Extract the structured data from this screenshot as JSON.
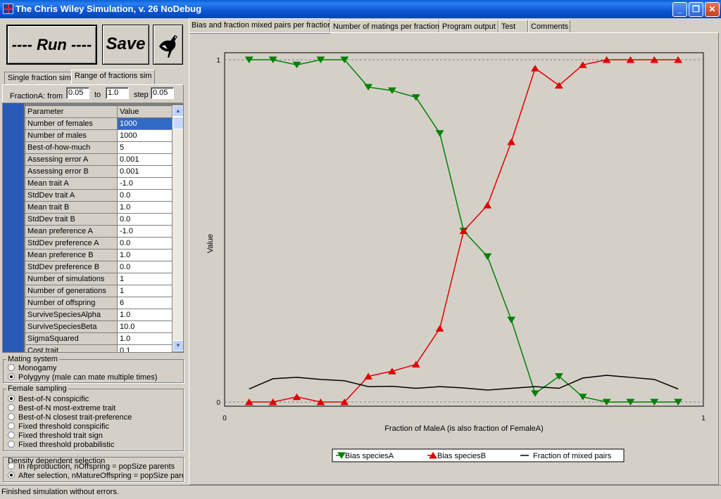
{
  "window": {
    "title": "The Chris Wiley Simulation, v. 26 NoDebug",
    "minimize": "_",
    "maximize": "❐",
    "close": "✕"
  },
  "toolbar": {
    "run_label": "---- Run ----",
    "save_label": "Save"
  },
  "left_tabs": [
    "Single fraction sim",
    "Range of fractions sim"
  ],
  "fraction_range": {
    "from_label": "FractionA: from",
    "from_value": "0.05",
    "to_label": "to",
    "to_value": "1.0",
    "step_label": "step",
    "step_value": "0.05"
  },
  "params": {
    "header": {
      "name": "Parameter",
      "value": "Value"
    },
    "rows": [
      {
        "name": "Number of females",
        "value": "1000"
      },
      {
        "name": "Number of males",
        "value": "1000"
      },
      {
        "name": "Best-of-how-much",
        "value": "5"
      },
      {
        "name": "Assessing error A",
        "value": "0.001"
      },
      {
        "name": "Assessing error B",
        "value": "0.001"
      },
      {
        "name": "Mean trait A",
        "value": "-1.0"
      },
      {
        "name": "StdDev trait A",
        "value": "0.0"
      },
      {
        "name": "Mean trait B",
        "value": "1.0"
      },
      {
        "name": "StdDev trait B",
        "value": "0.0"
      },
      {
        "name": "Mean preference A",
        "value": "-1.0"
      },
      {
        "name": "StdDev preference A",
        "value": "0.0"
      },
      {
        "name": "Mean preference B",
        "value": "1.0"
      },
      {
        "name": "StdDev preference B",
        "value": "0.0"
      },
      {
        "name": "Number of simulations",
        "value": "1"
      },
      {
        "name": "Number of generations",
        "value": "1"
      },
      {
        "name": "Number of offspring",
        "value": "6"
      },
      {
        "name": "SurviveSpeciesAlpha",
        "value": "1.0"
      },
      {
        "name": "SurviveSpeciesBeta",
        "value": "10.0"
      },
      {
        "name": "SigmaSquared",
        "value": "1.0"
      },
      {
        "name": "Cost trait",
        "value": "0.1"
      }
    ]
  },
  "mating_system": {
    "title": "Mating system",
    "options": [
      {
        "label": "Monogamy",
        "checked": false
      },
      {
        "label": "Polygyny (male can mate multiple times)",
        "checked": true
      }
    ]
  },
  "female_sampling": {
    "title": "Female sampling",
    "options": [
      {
        "label": "Best-of-N conspicific",
        "checked": true
      },
      {
        "label": "Best-of-N most-extreme trait",
        "checked": false
      },
      {
        "label": "Best-of-N closest trait-preference",
        "checked": false
      },
      {
        "label": "Fixed threshold conspicific",
        "checked": false
      },
      {
        "label": "Fixed threshold trait sign",
        "checked": false
      },
      {
        "label": "Fixed threshold probabilistic",
        "checked": false
      }
    ]
  },
  "density": {
    "title": "Density dependent selection",
    "options": [
      {
        "label": "In reproduction, nOffspring = popSize parents",
        "checked": false
      },
      {
        "label": "After selection, nMatureOffspring = popSize parents",
        "checked": true
      }
    ]
  },
  "right_tabs": [
    "Bias and fraction mixed pairs per fraction",
    "Number of matings per fraction",
    "Program output",
    "Test",
    "Comments"
  ],
  "status": "Finished simulation without errors.",
  "colors": {
    "green": "#008000",
    "red": "#e00000",
    "black": "#000000"
  },
  "chart_data": {
    "type": "line",
    "xlabel": "Fraction of MaleA (is also fraction of FemaleA)",
    "ylabel": "Value",
    "xlim": [
      0,
      1
    ],
    "ylim": [
      0,
      1
    ],
    "x_ticks": [
      "0",
      "1"
    ],
    "y_ticks": [
      "0",
      "1"
    ],
    "legend_position": "bottom",
    "x": [
      0.05,
      0.1,
      0.15,
      0.2,
      0.25,
      0.3,
      0.35,
      0.4,
      0.45,
      0.5,
      0.55,
      0.6,
      0.65,
      0.7,
      0.75,
      0.8,
      0.85,
      0.9,
      0.95
    ],
    "series": [
      {
        "name": "Bias speciesA",
        "color": "#008000",
        "marker": "triangle-down",
        "values": [
          1.0,
          1.0,
          0.985,
          1.0,
          1.0,
          0.92,
          0.91,
          0.89,
          0.785,
          0.5,
          0.425,
          0.24,
          0.025,
          0.075,
          0.015,
          0.0,
          0.0,
          0.0,
          0.0
        ]
      },
      {
        "name": "Bias speciesB",
        "color": "#e00000",
        "marker": "triangle-up",
        "values": [
          0.0,
          0.0,
          0.015,
          0.0,
          0.0,
          0.075,
          0.09,
          0.11,
          0.215,
          0.5,
          0.575,
          0.76,
          0.975,
          0.925,
          0.985,
          1.0,
          1.0,
          1.0,
          1.0
        ]
      },
      {
        "name": "Fraction of mixed pairs",
        "color": "#000000",
        "marker": "none",
        "values": [
          0.038,
          0.068,
          0.072,
          0.066,
          0.062,
          0.045,
          0.046,
          0.04,
          0.045,
          0.041,
          0.035,
          0.04,
          0.045,
          0.04,
          0.07,
          0.078,
          0.072,
          0.066,
          0.038
        ]
      }
    ]
  }
}
